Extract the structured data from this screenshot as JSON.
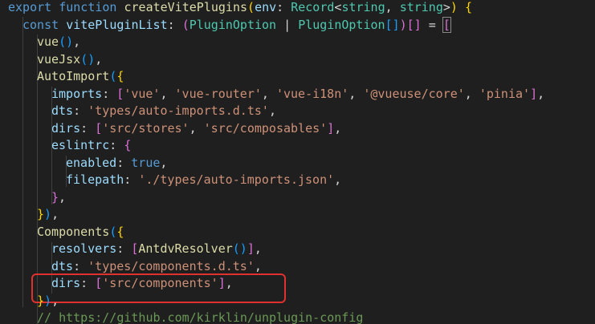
{
  "editor": {
    "language": "typescript",
    "lines": [
      [
        [
          "kw",
          "export"
        ],
        [
          "punc",
          " "
        ],
        [
          "kw",
          "function"
        ],
        [
          "punc",
          " "
        ],
        [
          "fn",
          "createVitePlugins"
        ],
        [
          "p0",
          "("
        ],
        [
          "var",
          "env"
        ],
        [
          "punc",
          ": "
        ],
        [
          "type",
          "Record"
        ],
        [
          "punc",
          "<"
        ],
        [
          "type",
          "string"
        ],
        [
          "punc",
          ", "
        ],
        [
          "type",
          "string"
        ],
        [
          "punc",
          ">"
        ],
        [
          "p0",
          ")"
        ],
        [
          "punc",
          " "
        ],
        [
          "p0",
          "{"
        ]
      ],
      [
        [
          "kw",
          "const"
        ],
        [
          "punc",
          " "
        ],
        [
          "var",
          "vitePluginList"
        ],
        [
          "punc",
          ": "
        ],
        [
          "p1",
          "("
        ],
        [
          "type",
          "PluginOption"
        ],
        [
          "punc",
          " | "
        ],
        [
          "type",
          "PluginOption"
        ],
        [
          "p2",
          "[]"
        ],
        [
          "p1",
          ")"
        ],
        [
          "p1",
          "[]"
        ],
        [
          "punc",
          " = "
        ],
        [
          "p1",
          "["
        ]
      ],
      [
        [
          "fn",
          "vue"
        ],
        [
          "p2",
          "()"
        ],
        [
          "punc",
          ","
        ]
      ],
      [
        [
          "fn",
          "vueJsx"
        ],
        [
          "p2",
          "()"
        ],
        [
          "punc",
          ","
        ]
      ],
      [
        [
          "fn",
          "AutoImport"
        ],
        [
          "p2",
          "("
        ],
        [
          "p0",
          "{"
        ]
      ],
      [
        [
          "var",
          "imports"
        ],
        [
          "punc",
          ": "
        ],
        [
          "p1",
          "["
        ],
        [
          "str",
          "'vue'"
        ],
        [
          "punc",
          ", "
        ],
        [
          "str",
          "'vue-router'"
        ],
        [
          "punc",
          ", "
        ],
        [
          "str",
          "'vue-i18n'"
        ],
        [
          "punc",
          ", "
        ],
        [
          "str",
          "'@vueuse/core'"
        ],
        [
          "punc",
          ", "
        ],
        [
          "str",
          "'pinia'"
        ],
        [
          "p1",
          "]"
        ],
        [
          "punc",
          ","
        ]
      ],
      [
        [
          "var",
          "dts"
        ],
        [
          "punc",
          ": "
        ],
        [
          "str",
          "'types/auto-imports.d.ts'"
        ],
        [
          "punc",
          ","
        ]
      ],
      [
        [
          "var",
          "dirs"
        ],
        [
          "punc",
          ": "
        ],
        [
          "p1",
          "["
        ],
        [
          "str",
          "'src/stores'"
        ],
        [
          "punc",
          ", "
        ],
        [
          "str",
          "'src/composables'"
        ],
        [
          "p1",
          "]"
        ],
        [
          "punc",
          ","
        ]
      ],
      [
        [
          "var",
          "eslintrc"
        ],
        [
          "punc",
          ": "
        ],
        [
          "p1",
          "{"
        ]
      ],
      [
        [
          "var",
          "enabled"
        ],
        [
          "punc",
          ": "
        ],
        [
          "bool",
          "true"
        ],
        [
          "punc",
          ","
        ]
      ],
      [
        [
          "var",
          "filepath"
        ],
        [
          "punc",
          ": "
        ],
        [
          "str",
          "'./types/auto-imports.json'"
        ],
        [
          "punc",
          ","
        ]
      ],
      [
        [
          "p1",
          "}"
        ],
        [
          "punc",
          ","
        ]
      ],
      [
        [
          "p0",
          "}"
        ],
        [
          "p2",
          ")"
        ],
        [
          "punc",
          ","
        ]
      ],
      [
        [
          "fn",
          "Components"
        ],
        [
          "p2",
          "("
        ],
        [
          "p0",
          "{"
        ]
      ],
      [
        [
          "var",
          "resolvers"
        ],
        [
          "punc",
          ": "
        ],
        [
          "p1",
          "["
        ],
        [
          "fn",
          "AntdvResolver"
        ],
        [
          "p2",
          "()"
        ],
        [
          "p1",
          "]"
        ],
        [
          "punc",
          ","
        ]
      ],
      [
        [
          "var",
          "dts"
        ],
        [
          "punc",
          ": "
        ],
        [
          "str",
          "'types/components.d.ts'"
        ],
        [
          "punc",
          ","
        ]
      ],
      [
        [
          "var",
          "dirs"
        ],
        [
          "punc",
          ": "
        ],
        [
          "p1",
          "["
        ],
        [
          "str",
          "'src/components'"
        ],
        [
          "p1",
          "]"
        ],
        [
          "punc",
          ","
        ]
      ],
      [
        [
          "p0",
          "}"
        ],
        [
          "p2",
          ")"
        ],
        [
          "punc",
          ","
        ]
      ],
      [
        [
          "cmt",
          "// https://github.com/kirklin/unplugin-config"
        ]
      ]
    ]
  },
  "annotation": {
    "color": "#e0312f",
    "target": "dirs: ['src/components'],"
  }
}
